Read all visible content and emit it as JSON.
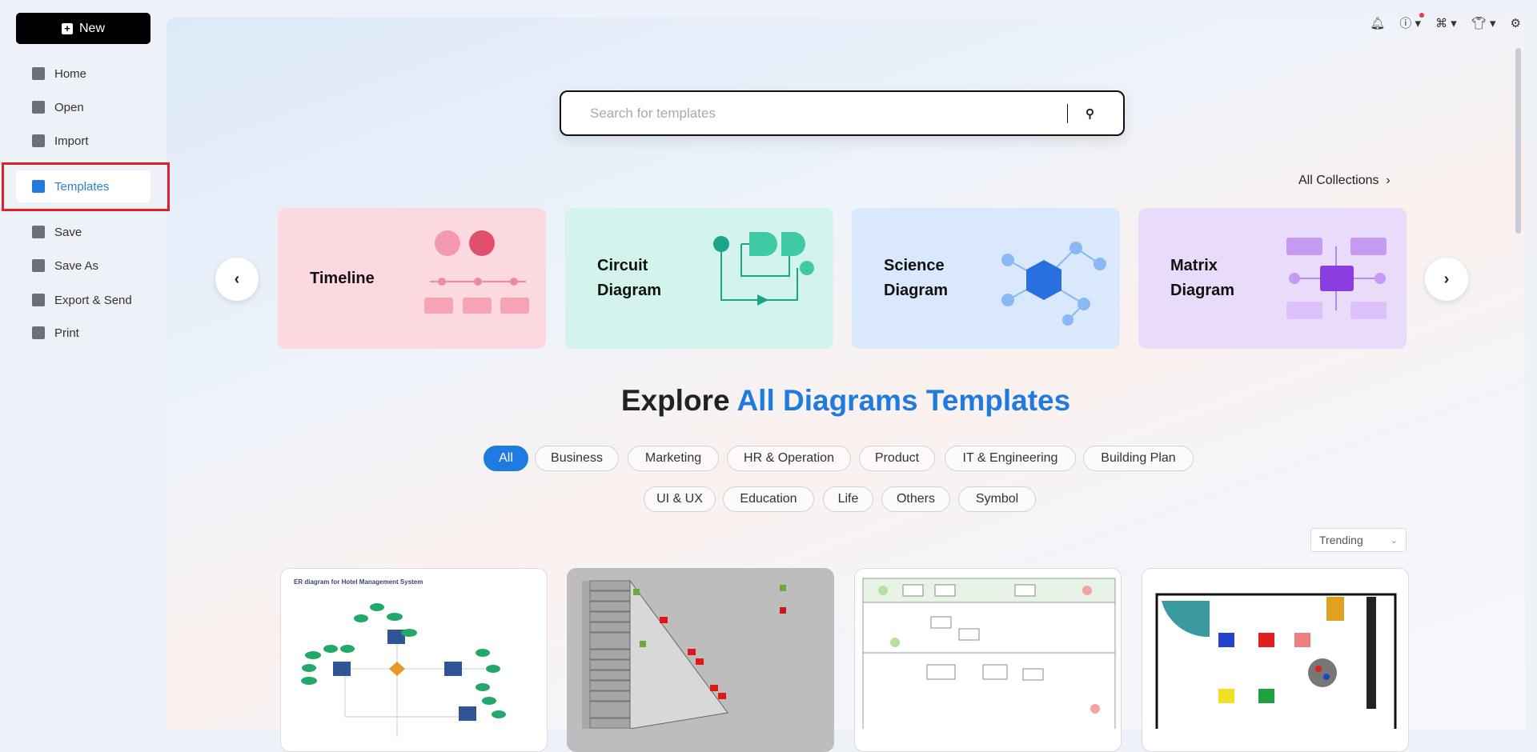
{
  "sidebar": {
    "new_label": "New",
    "items": [
      {
        "label": "Home",
        "icon": "home-icon"
      },
      {
        "label": "Open",
        "icon": "file-icon"
      },
      {
        "label": "Import",
        "icon": "import-icon"
      },
      {
        "label": "Templates",
        "icon": "templates-icon",
        "active": true
      },
      {
        "label": "Save",
        "icon": "save-icon"
      },
      {
        "label": "Save As",
        "icon": "save-as-icon"
      },
      {
        "label": "Export & Send",
        "icon": "export-icon"
      },
      {
        "label": "Print",
        "icon": "print-icon"
      }
    ]
  },
  "topbar": {
    "icons": [
      "bell-icon",
      "help-icon",
      "apps-icon",
      "theme-icon",
      "settings-icon"
    ],
    "notification_color": "#f0394d"
  },
  "search": {
    "placeholder": "Search for templates"
  },
  "collections": {
    "all_label": "All Collections",
    "cards": [
      {
        "label": "Timeline",
        "color": "#fcd9e0"
      },
      {
        "label": "Circuit Diagram",
        "color": "#d3f4ec"
      },
      {
        "label": "Science Diagram",
        "color": "#d9e8fc"
      },
      {
        "label": "Matrix Diagram",
        "color": "#e9dcfb"
      }
    ]
  },
  "explore": {
    "heading_prefix": "Explore ",
    "heading_highlight": "All Diagrams Templates"
  },
  "filters": [
    "All",
    "Business",
    "Marketing",
    "HR & Operation",
    "Product",
    "IT & Engineering",
    "Building Plan",
    "UI & UX",
    "Education",
    "Life",
    "Others",
    "Symbol"
  ],
  "active_filter": "All",
  "sort": {
    "selected": "Trending"
  },
  "templates": [
    {
      "title": "ER diagram for Hotel Management System"
    },
    {
      "title": ""
    },
    {
      "title": ""
    },
    {
      "title": ""
    }
  ],
  "accent": "#1f7be0"
}
